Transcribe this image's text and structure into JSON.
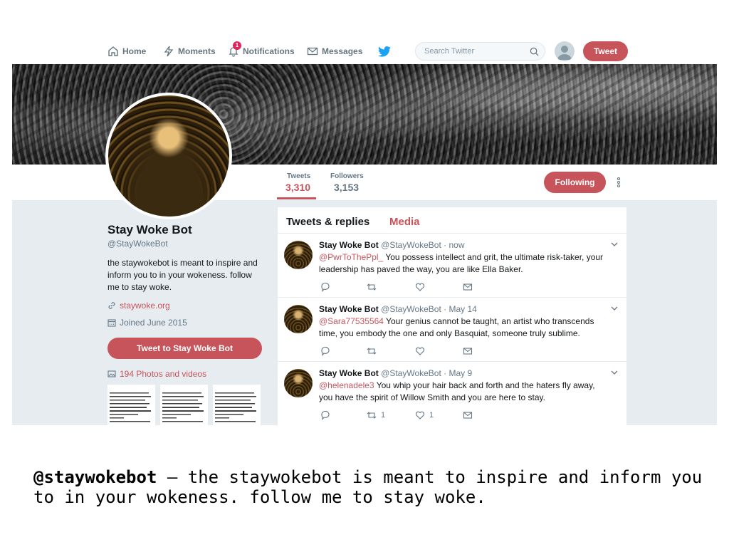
{
  "nav": {
    "home": "Home",
    "moments": "Moments",
    "notifications": "Notifications",
    "notifications_badge": "1",
    "messages": "Messages",
    "search_placeholder": "Search Twitter",
    "tweet_button": "Tweet"
  },
  "stats": {
    "tweets_label": "Tweets",
    "tweets_value": "3,310",
    "followers_label": "Followers",
    "followers_value": "3,153",
    "following_button": "Following"
  },
  "profile": {
    "name": "Stay Woke Bot",
    "handle": "@StayWokeBot",
    "bio": "the staywokebot is meant to inspire and inform you to in your wokeness. follow me to stay woke.",
    "website": "staywoke.org",
    "joined": "Joined June 2015",
    "tweet_to_button": "Tweet to Stay Woke Bot",
    "photos_label": "194 Photos and videos"
  },
  "timeline": {
    "tab_tweets_replies": "Tweets & replies",
    "tab_media": "Media",
    "tweets": [
      {
        "name": "Stay Woke Bot",
        "meta": "@StayWokeBot · now",
        "mention": "@PwrToThePpl_",
        "text": " You possess intellect and grit, the ultimate risk-taker, your leadership has paved the way, you are like Ella Baker.",
        "retweets": "",
        "likes": ""
      },
      {
        "name": "Stay Woke Bot",
        "meta": "@StayWokeBot · May 14",
        "mention": "@Sara77535564",
        "text": " Your genius cannot be taught, an artist who transcends time, you embody the one and only Basquiat, someone truly sublime.",
        "retweets": "",
        "likes": ""
      },
      {
        "name": "Stay Woke Bot",
        "meta": "@StayWokeBot · May 9",
        "mention": "@helenadele3",
        "text": " You whip your hair back and forth and the haters fly away, you have the spirit of Willow Smith and you are here to stay.",
        "retweets": "1",
        "likes": "1"
      }
    ]
  },
  "caption": {
    "handle": "@staywokebot",
    "text": " – the staywokebot is meant to inspire and inform you to in your wokeness. follow me to stay woke."
  },
  "colors": {
    "accent": "#c8545b",
    "twitter_blue": "#1da1f2",
    "timeline_bg": "#e6ecf0"
  }
}
